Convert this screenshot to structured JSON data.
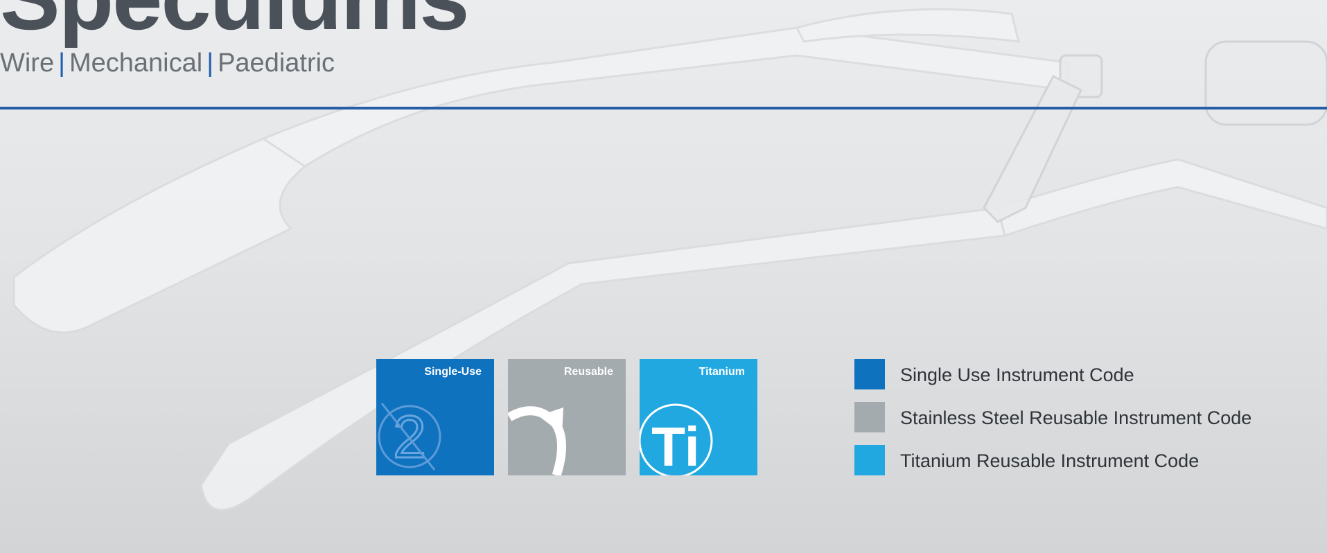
{
  "header": {
    "title": "Speculums",
    "subtitle_parts": [
      "Wire",
      "Mechanical",
      "Paediatric"
    ],
    "subtitle_separator": "|"
  },
  "icons": [
    {
      "label": "Single-Use",
      "icon": "no-reuse-2-icon",
      "color": "#0f72bf"
    },
    {
      "label": "Reusable",
      "icon": "reuse-arrow-icon",
      "color": "#a4abaf"
    },
    {
      "label": "Titanium",
      "icon": "titanium-ti-icon",
      "color": "#22a8e0",
      "glyph": "Ti"
    }
  ],
  "legend": [
    {
      "label": "Single Use Instrument Code",
      "color": "#0f72bf"
    },
    {
      "label": "Stainless Steel Reusable Instrument Code",
      "color": "#a4abaf"
    },
    {
      "label": "Titanium Reusable Instrument Code",
      "color": "#22a8e0"
    }
  ],
  "colors": {
    "accent": "#255ea8",
    "title": "#4b5159",
    "subtitle": "#6b7077"
  }
}
